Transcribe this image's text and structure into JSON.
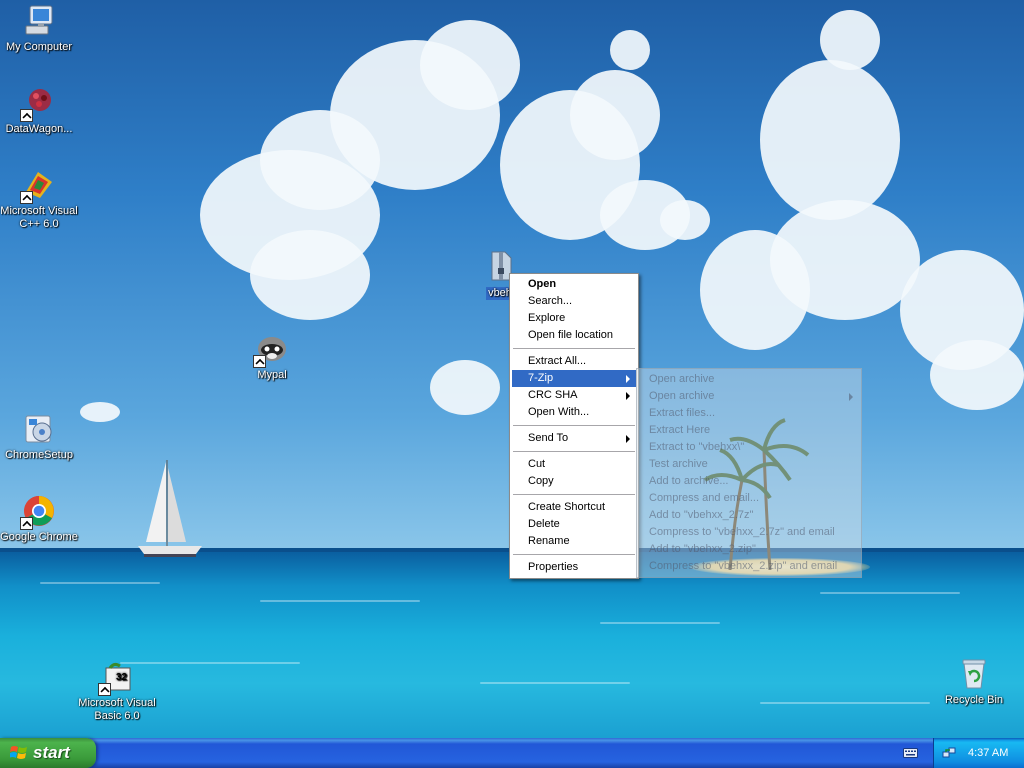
{
  "desktop": {
    "icons": [
      {
        "label": "My Computer",
        "icon": "my-computer-icon"
      },
      {
        "label": "DataWagon...",
        "icon": "datawagon-icon"
      },
      {
        "label": "Microsoft Visual C++ 6.0",
        "icon": "visual-cpp-icon"
      },
      {
        "label": "Mypal",
        "icon": "mypal-icon"
      },
      {
        "label": "ChromeSetup",
        "icon": "chrome-setup-icon"
      },
      {
        "label": "Google Chrome",
        "icon": "chrome-icon"
      },
      {
        "label": "Microsoft Visual Basic 6.0",
        "icon": "visual-basic-icon"
      },
      {
        "label": "Recycle Bin",
        "icon": "recycle-bin-icon"
      }
    ],
    "selected_file": {
      "label": "vbeh",
      "icon": "zip-file-icon"
    }
  },
  "context_menu": {
    "groups": [
      [
        {
          "label": "Open",
          "bold": true
        },
        {
          "label": "Search..."
        },
        {
          "label": "Explore"
        },
        {
          "label": "Open file location"
        }
      ],
      [
        {
          "label": "Extract All..."
        },
        {
          "label": "7-Zip",
          "submenu": true,
          "highlighted": true
        },
        {
          "label": "CRC SHA",
          "submenu": true
        },
        {
          "label": "Open With..."
        }
      ],
      [
        {
          "label": "Send To",
          "submenu": true
        }
      ],
      [
        {
          "label": "Cut"
        },
        {
          "label": "Copy"
        }
      ],
      [
        {
          "label": "Create Shortcut"
        },
        {
          "label": "Delete"
        },
        {
          "label": "Rename"
        }
      ],
      [
        {
          "label": "Properties"
        }
      ]
    ]
  },
  "sevenzip_submenu": {
    "items": [
      {
        "label": "Open archive"
      },
      {
        "label": "Open archive",
        "submenu": true
      },
      {
        "label": "Extract files..."
      },
      {
        "label": "Extract Here"
      },
      {
        "label": "Extract to \"vbehxx\\\""
      },
      {
        "label": "Test archive"
      },
      {
        "label": "Add to archive..."
      },
      {
        "label": "Compress and email..."
      },
      {
        "label": "Add to \"vbehxx_2.7z\""
      },
      {
        "label": "Compress to \"vbehxx_2.7z\" and email"
      },
      {
        "label": "Add to \"vbehxx_2.zip\""
      },
      {
        "label": "Compress to \"vbehxx_2.zip\" and email"
      }
    ]
  },
  "taskbar": {
    "start_label": "start",
    "clock": "4:37 AM"
  },
  "colors": {
    "highlight": "#316ac5",
    "taskbar": "#2663e0",
    "start_button": "#3a9a3a"
  }
}
